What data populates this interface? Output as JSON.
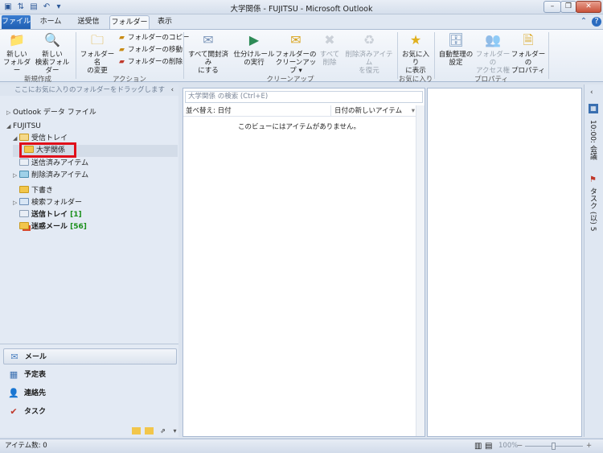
{
  "window": {
    "title": "大学関係 - FUJITSU - Microsoft Outlook",
    "qa_icons": [
      "outlook-app-icon",
      "send-receive-icon",
      "save-icon",
      "undo-icon",
      "customize-icon"
    ],
    "controls": {
      "minimize": "–",
      "restore": "❐",
      "close": "✕"
    }
  },
  "tabs": [
    "ファイル",
    "ホーム",
    "送受信",
    "フォルダー",
    "表示"
  ],
  "active_tab": "フォルダー",
  "ribbon": {
    "new_folder": [
      "新しい",
      "フォルダー"
    ],
    "new_search_folder": [
      "新しい",
      "検索フォルダー"
    ],
    "group_new": "新規作成",
    "rename_folder": [
      "フォルダー名",
      "の変更"
    ],
    "copy_folder": "フォルダーのコピー",
    "move_folder": "フォルダーの移動",
    "delete_folder": "フォルダーの削除",
    "group_actions": "アクション",
    "mark_all_read": [
      "すべて開封済み",
      "にする"
    ],
    "run_rules": [
      "仕分けルール",
      "の実行"
    ],
    "clean_up": [
      "フォルダーの",
      "クリーンアップ ▾"
    ],
    "delete_all": [
      "すべて",
      "削除"
    ],
    "recover_deleted": [
      "削除済みアイテム",
      "を復元"
    ],
    "group_cleanup": "クリーンアップ",
    "show_in_favorites": [
      "お気に入り",
      "に表示"
    ],
    "group_favorites": "お気に入り",
    "autoarchive": [
      "自動整理の",
      "設定"
    ],
    "folder_permissions": [
      "フォルダーの",
      "アクセス権"
    ],
    "folder_properties": [
      "フォルダーの",
      "プロパティ"
    ],
    "group_properties": "プロパティ"
  },
  "nav": {
    "favorites_hint": "ここにお気に入りのフォルダーをドラッグします",
    "outlook_data_file": "Outlook データ ファイル",
    "account": "FUJITSU",
    "inbox": "受信トレイ",
    "selected_folder": "大学関係",
    "sent": "送信済みアイテム",
    "deleted": "削除済みアイテム",
    "drafts": "下書き",
    "search_folders": "検索フォルダー",
    "outbox": "送信トレイ",
    "outbox_count": "[1]",
    "junk": "迷惑メール",
    "junk_count": "[56]",
    "buttons": [
      "メール",
      "予定表",
      "連絡先",
      "タスク"
    ]
  },
  "list": {
    "search_placeholder": "大学関係 の検索 (Ctrl+E)",
    "sort_by": "並べ替え: 日付",
    "sort_order": "日付の新しいアイテム",
    "empty_message": "このビューにはアイテムがありません。"
  },
  "todo": {
    "time": "10:00: 会議",
    "tasks": "タスク (以) 5"
  },
  "status": {
    "item_count": "アイテム数: 0",
    "zoom": "100%"
  },
  "colors": {
    "accent": "#1f5fb3",
    "selection_highlight": "#e0101a",
    "count_green": "#1a8f1a"
  }
}
